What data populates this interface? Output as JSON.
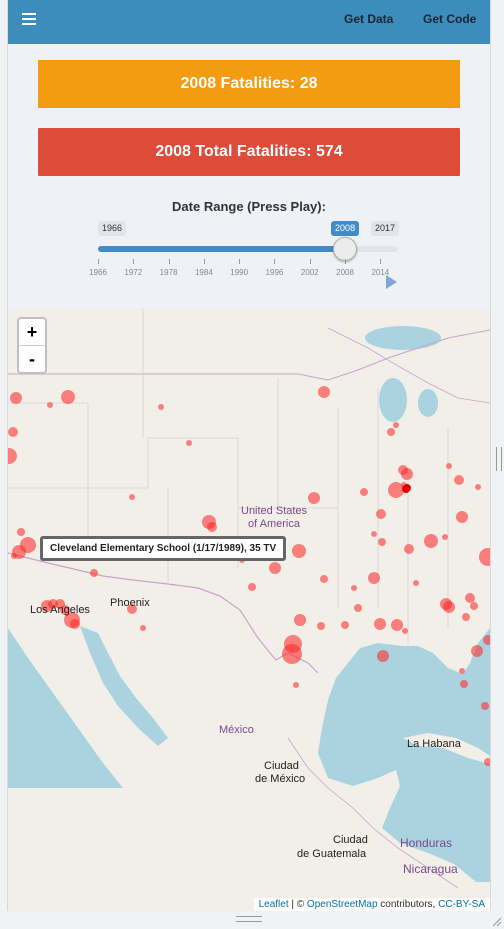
{
  "navbar": {
    "get_data": "Get Data",
    "get_code": "Get Code",
    "color": "#3c8dbc"
  },
  "value_boxes": {
    "fatalities": "2008 Fatalities: 28",
    "total_fatalities": "2008 Total Fatalities: 574",
    "fatalities_color": "#f39c12",
    "total_color": "#dd4b39"
  },
  "slider": {
    "title": "Date Range (Press Play):",
    "min_label": "1966",
    "max_label": "2017",
    "current_label": "2008",
    "min": 1966,
    "max": 2017,
    "value": 2008,
    "ticks": [
      "1966",
      "1972",
      "1978",
      "1984",
      "1990",
      "1996",
      "2002",
      "2008",
      "2014"
    ]
  },
  "map": {
    "zoom_in": "+",
    "zoom_out": "-",
    "tooltip": "Cleveland Elementary School (1/17/1989), 35 TV",
    "labels": {
      "usa": "United States",
      "usa2": "of America",
      "los_angeles": "Los Angeles",
      "phoenix": "Phoenix",
      "mexico": "México",
      "ciudad_mexico": "Ciudad",
      "ciudad_mexico2": "de México",
      "la_habana": "La Habana",
      "ciudad_guatemala": "Ciudad",
      "ciudad_guatemala2": "de Guatemala",
      "honduras": "Honduras",
      "nicaragua": "Nicaragua"
    },
    "marker_color": "#ff2020",
    "attribution": {
      "leaflet": "Leaflet",
      "separator": " | © ",
      "osm": "OpenStreetMap",
      "contributors": " contributors, ",
      "license": "CC-BY-SA"
    }
  },
  "icons": {
    "menu": "menu-icon",
    "play": "play-icon",
    "resize": "resize-grip-icon"
  }
}
